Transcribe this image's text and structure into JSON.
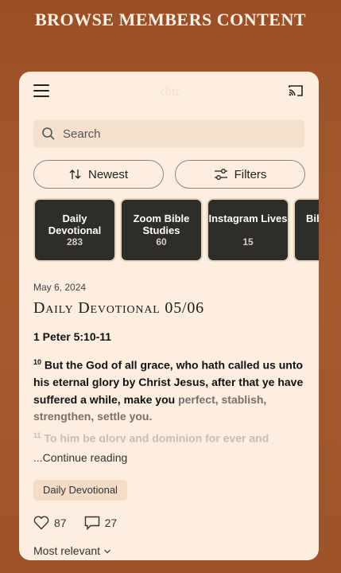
{
  "banner": "BROWSE MEMBERS CONTENT",
  "header": {
    "logo_text": "𝔠𝔥𝔦𝔯"
  },
  "search": {
    "placeholder": "Search"
  },
  "sort_button": {
    "label": "Newest"
  },
  "filter_button": {
    "label": "Filters"
  },
  "categories": [
    {
      "title": "Daily Devotional",
      "count": "283"
    },
    {
      "title": "Zoom Bible Studies",
      "count": "60"
    },
    {
      "title": "Instagram Lives",
      "count": "15"
    },
    {
      "title": "Bib",
      "count": ""
    }
  ],
  "post": {
    "date": "May 6, 2024",
    "title": "Daily Devotional 05/06",
    "reference": "1 Peter 5:10-11",
    "verse10_num": "10",
    "verse10_text": "But the God of all grace, who hath called us unto his eternal glory by Christ Jesus, after that ye have suffered a while, make you",
    "verse10_faded": "perfect, stablish, strengthen, settle you.",
    "verse11_num": "11",
    "verse11_text": "To him be glory and dominion for ever and",
    "continue": "...Continue reading",
    "tag": "Daily Devotional",
    "likes": "87",
    "comments": "27"
  },
  "footer": {
    "sort_label": "Most relevant"
  }
}
